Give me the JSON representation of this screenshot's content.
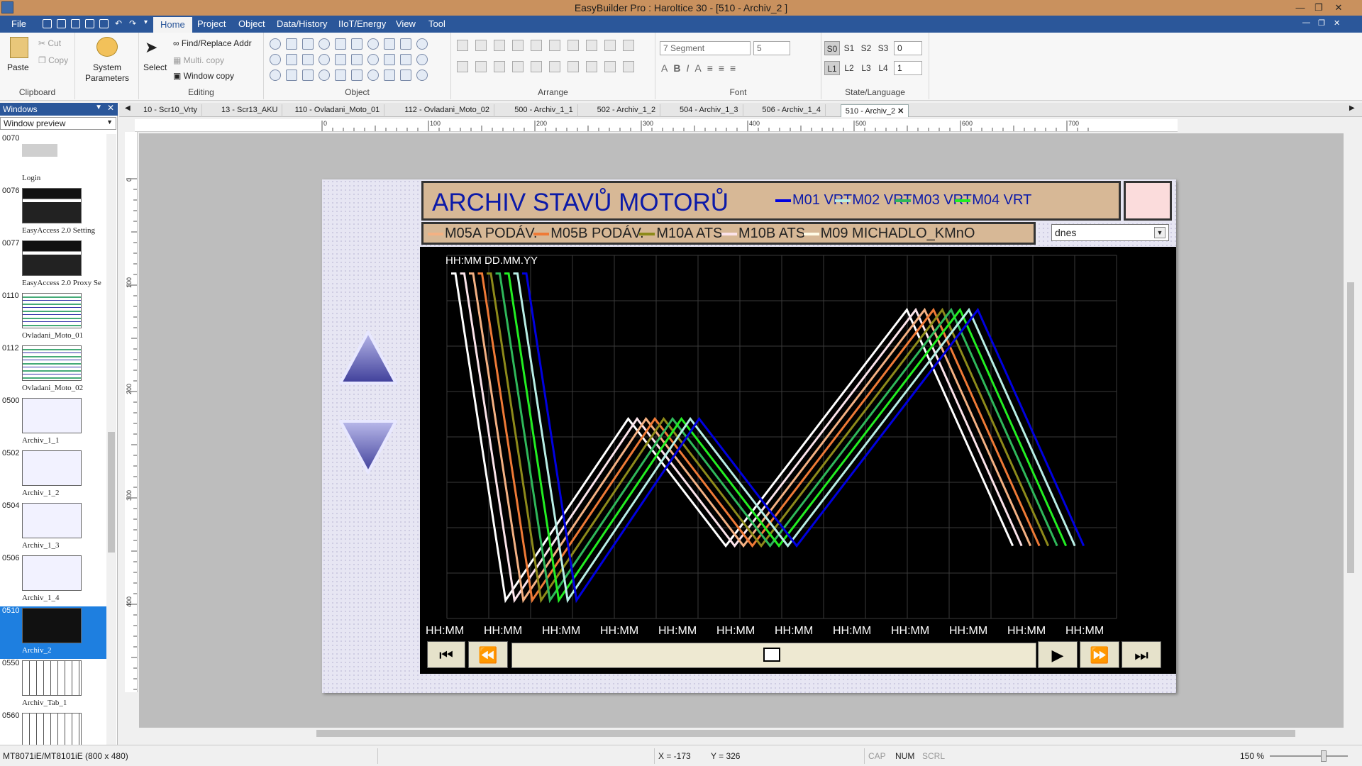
{
  "window": {
    "title": "EasyBuilder Pro : Haroltice 30 - [510 - Archiv_2 ]"
  },
  "menu": {
    "file": "File",
    "items": [
      "Home",
      "Project",
      "Object",
      "Data/History",
      "IIoT/Energy",
      "View",
      "Tool"
    ]
  },
  "ribbon": {
    "paste": "Paste",
    "cut": "Cut",
    "copy": "Copy",
    "clipboard": "Clipboard",
    "system_parameters_1": "System",
    "system_parameters_2": "Parameters",
    "select": "Select",
    "find_replace": "Find/Replace Addr",
    "multi_copy": "Multi. copy",
    "window_copy": "Window copy",
    "editing": "Editing",
    "object": "Object",
    "arrange": "Arrange",
    "font_name": "7 Segment",
    "font_size": "5",
    "font": "Font",
    "states": [
      "S0",
      "S1",
      "S2",
      "S3"
    ],
    "state_value": "0",
    "languages": [
      "L1",
      "L2",
      "L3",
      "L4"
    ],
    "language_value": "1",
    "state_language": "State/Language"
  },
  "left_panel": {
    "header": "Windows",
    "dropdown": "Window preview",
    "items": [
      {
        "num": "0070",
        "label": "Login"
      },
      {
        "num": "0076",
        "label": "EasyAccess 2.0 Setting"
      },
      {
        "num": "0077",
        "label": "EasyAccess 2.0 Proxy Se"
      },
      {
        "num": "0110",
        "label": "Ovladani_Moto_01"
      },
      {
        "num": "0112",
        "label": "Ovladani_Moto_02"
      },
      {
        "num": "0500",
        "label": "Archiv_1_1"
      },
      {
        "num": "0502",
        "label": "Archiv_1_2"
      },
      {
        "num": "0504",
        "label": "Archiv_1_3"
      },
      {
        "num": "0506",
        "label": "Archiv_1_4"
      },
      {
        "num": "0510",
        "label": "Archiv_2"
      },
      {
        "num": "0550",
        "label": "Archiv_Tab_1"
      },
      {
        "num": "0560",
        "label": ""
      }
    ]
  },
  "tabs": [
    "10 - Scr10_Vrty",
    "13 - Scr13_AKU",
    "110 - Ovladani_Moto_01",
    "112 - Ovladani_Moto_02",
    "500 - Archiv_1_1",
    "502 - Archiv_1_2",
    "504 - Archiv_1_3",
    "506 - Archiv_1_4",
    "510 - Archiv_2"
  ],
  "ruler": {
    "h": [
      "0",
      "100",
      "200",
      "300",
      "400",
      "500",
      "600",
      "700"
    ],
    "v": [
      "0",
      "100",
      "200",
      "300",
      "400"
    ]
  },
  "hmi": {
    "title": "ARCHIV STAVŮ MOTORŮ",
    "legend_row1": [
      {
        "name": "M01 VRT",
        "color": "#0000e0"
      },
      {
        "name": "M02 VRT",
        "color": "#b8eee6"
      },
      {
        "name": "M03 VRT",
        "color": "#2fb85a"
      },
      {
        "name": "M04 VRT",
        "color": "#22ee22"
      }
    ],
    "legend_row2": [
      {
        "name": "M05A PODÁV.",
        "color": "#f4b183"
      },
      {
        "name": "M05B PODÁV.",
        "color": "#ef7a36"
      },
      {
        "name": "M10A ATS",
        "color": "#8d8a1a"
      },
      {
        "name": "M10B ATS",
        "color": "#fbe3ea"
      },
      {
        "name": "M09 MICHADLO_KMnO",
        "color": "#fffbe6"
      }
    ],
    "select": "dnes",
    "time_label": "HH:MM DD.MM.YY",
    "x_ticks": [
      "HH:MM",
      "HH:MM",
      "HH:MM",
      "HH:MM",
      "HH:MM",
      "HH:MM",
      "HH:MM",
      "HH:MM",
      "HH:MM",
      "HH:MM",
      "HH:MM",
      "HH:MM"
    ]
  },
  "chart_data": {
    "type": "line",
    "title": "",
    "xlabel": "",
    "ylabel": "",
    "x": [
      0,
      1,
      2,
      3,
      4,
      5
    ],
    "series": [
      {
        "name": "M09 MICHADLO_KMnO",
        "color": "#ffffff",
        "values": [
          0.95,
          0.05,
          0.55,
          0.2,
          0.85,
          0.2
        ]
      },
      {
        "name": "M10B ATS",
        "color": "#fbe3ea",
        "values": [
          0.95,
          0.05,
          0.55,
          0.2,
          0.85,
          0.2
        ]
      },
      {
        "name": "M05A PODÁV.",
        "color": "#f4b183",
        "values": [
          0.95,
          0.05,
          0.55,
          0.2,
          0.85,
          0.2
        ]
      },
      {
        "name": "M05B PODÁV.",
        "color": "#ef7a36",
        "values": [
          0.95,
          0.05,
          0.55,
          0.2,
          0.85,
          0.2
        ]
      },
      {
        "name": "M10A ATS",
        "color": "#8d8a1a",
        "values": [
          0.95,
          0.05,
          0.55,
          0.2,
          0.85,
          0.2
        ]
      },
      {
        "name": "M03 VRT",
        "color": "#2fb85a",
        "values": [
          0.95,
          0.05,
          0.55,
          0.2,
          0.85,
          0.2
        ]
      },
      {
        "name": "M04 VRT",
        "color": "#22ee22",
        "values": [
          0.95,
          0.05,
          0.55,
          0.2,
          0.85,
          0.2
        ]
      },
      {
        "name": "M02 VRT",
        "color": "#b8eee6",
        "values": [
          0.95,
          0.05,
          0.55,
          0.2,
          0.85,
          0.2
        ]
      },
      {
        "name": "M01 VRT",
        "color": "#0000e0",
        "values": [
          0.95,
          0.05,
          0.55,
          0.2,
          0.85,
          0.2
        ]
      }
    ],
    "grid": true
  },
  "status": {
    "device": "MT8071iE/MT8101iE (800 x 480)",
    "x": "X = -173",
    "y": "Y = 326",
    "cap": "CAP",
    "num": "NUM",
    "scrl": "SCRL",
    "zoom": "150 %"
  }
}
